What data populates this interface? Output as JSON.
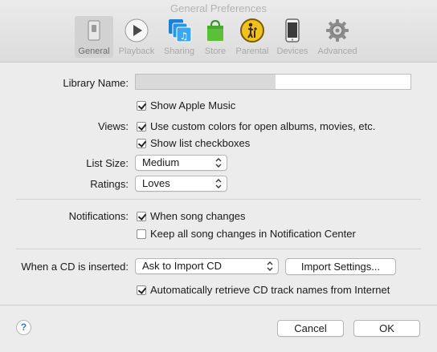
{
  "window": {
    "title": "General Preferences"
  },
  "toolbar": {
    "items": [
      {
        "label": "General",
        "icon": "general-switch-icon",
        "selected": true
      },
      {
        "label": "Playback",
        "icon": "play-icon",
        "selected": false
      },
      {
        "label": "Sharing",
        "icon": "sharing-music-icon",
        "selected": false
      },
      {
        "label": "Store",
        "icon": "shopping-bag-icon",
        "selected": false
      },
      {
        "label": "Parental",
        "icon": "parental-icon",
        "selected": false
      },
      {
        "label": "Devices",
        "icon": "iphone-icon",
        "selected": false
      },
      {
        "label": "Advanced",
        "icon": "gear-icon",
        "selected": false
      }
    ]
  },
  "general": {
    "library_name_label": "Library Name:",
    "library_name_value": "",
    "show_apple_music": {
      "label": "Show Apple Music",
      "checked": true
    },
    "views_label": "Views:",
    "custom_colors": {
      "label": "Use custom colors for open albums, movies, etc.",
      "checked": true
    },
    "list_checkboxes": {
      "label": "Show list checkboxes",
      "checked": true
    },
    "list_size_label": "List Size:",
    "list_size_value": "Medium",
    "ratings_label": "Ratings:",
    "ratings_value": "Loves",
    "notifications_label": "Notifications:",
    "song_changes": {
      "label": "When song changes",
      "checked": true
    },
    "keep_all_changes": {
      "label": "Keep all song changes in Notification Center",
      "checked": false
    },
    "cd_label": "When a CD is inserted:",
    "cd_value": "Ask to Import CD",
    "import_settings_label": "Import Settings...",
    "retrieve_names": {
      "label": "Automatically retrieve CD track names from Internet",
      "checked": true
    }
  },
  "footer": {
    "help_label": "?",
    "cancel_label": "Cancel",
    "ok_label": "OK"
  }
}
